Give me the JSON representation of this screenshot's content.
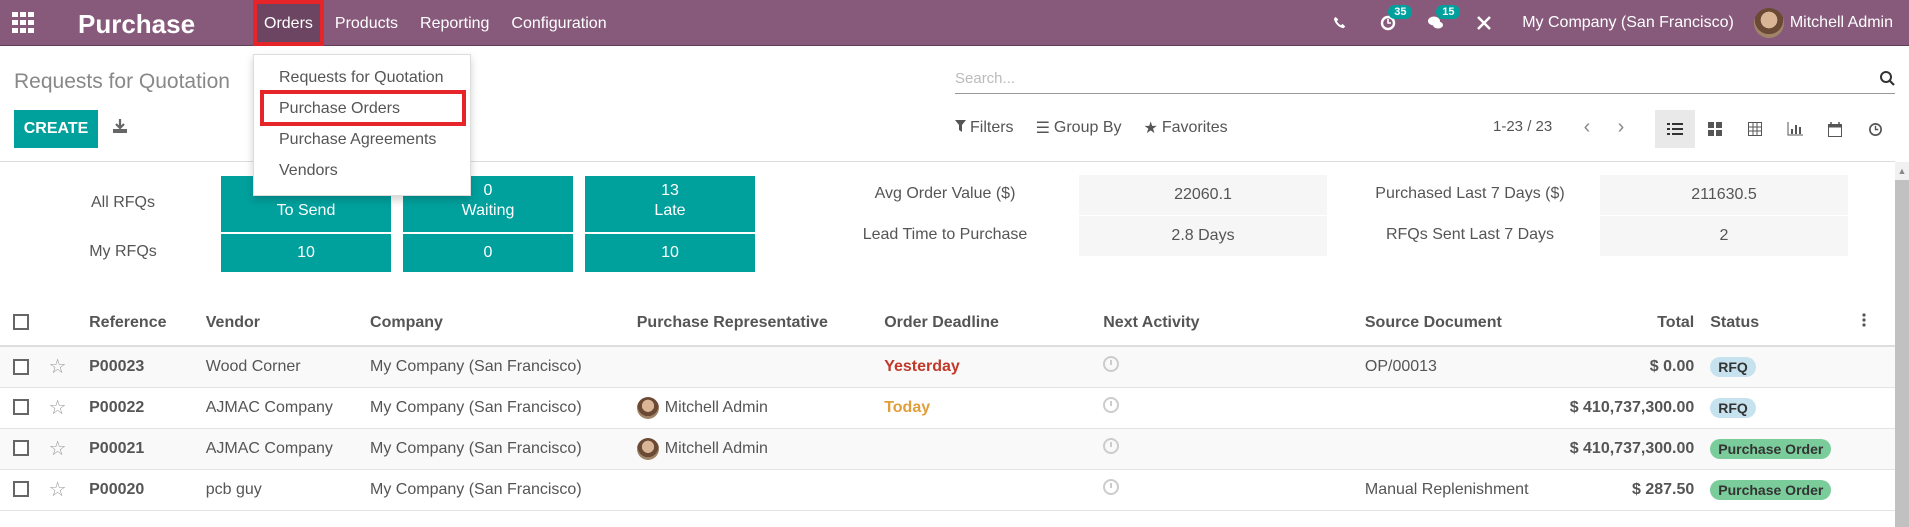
{
  "navbar": {
    "app_title": "Purchase",
    "menus": [
      "Orders",
      "Products",
      "Reporting",
      "Configuration"
    ],
    "active_menu": "Orders",
    "activity_count": "35",
    "message_count": "15",
    "company": "My Company (San Francisco)",
    "user": "Mitchell Admin"
  },
  "orders_dropdown": {
    "items": [
      "Requests for Quotation",
      "Purchase Orders",
      "Purchase Agreements",
      "Vendors"
    ],
    "highlighted": "Purchase Orders"
  },
  "control_panel": {
    "title": "Requests for Quotation",
    "create_label": "CREATE",
    "search_placeholder": "Search...",
    "filters_label": "Filters",
    "groupby_label": "Group By",
    "favorites_label": "Favorites",
    "pager": "1-23 / 23",
    "views": [
      "list",
      "kanban",
      "pivot",
      "graph",
      "calendar",
      "activity"
    ],
    "active_view": "list"
  },
  "dashboard": {
    "row_labels": [
      "All RFQs",
      "My RFQs"
    ],
    "tiles": [
      {
        "label": "To Send",
        "all": "",
        "my": "10"
      },
      {
        "label": "Waiting",
        "all": "0",
        "my": "0"
      },
      {
        "label": "Late",
        "all": "13",
        "my": "10"
      }
    ],
    "kpis": [
      {
        "label": "Avg Order Value ($)",
        "value": "22060.1"
      },
      {
        "label": "Purchased Last 7 Days ($)",
        "value": "211630.5"
      },
      {
        "label": "Lead Time to Purchase",
        "value": "2.8  Days"
      },
      {
        "label": "RFQs Sent Last 7 Days",
        "value": "2"
      }
    ]
  },
  "table": {
    "columns": [
      "Reference",
      "Vendor",
      "Company",
      "Purchase Representative",
      "Order Deadline",
      "Next Activity",
      "Source Document",
      "Total",
      "Status"
    ],
    "rows": [
      {
        "reference": "P00023",
        "vendor": "Wood Corner",
        "company": "My Company (San Francisco)",
        "rep": "",
        "deadline": "Yesterday",
        "deadline_state": "overdue",
        "source": "OP/00013",
        "total": "$ 0.00",
        "status": "RFQ"
      },
      {
        "reference": "P00022",
        "vendor": "AJMAC Company",
        "company": "My Company (San Francisco)",
        "rep": "Mitchell Admin",
        "deadline": "Today",
        "deadline_state": "today",
        "source": "",
        "total": "$ 410,737,300.00",
        "status": "RFQ"
      },
      {
        "reference": "P00021",
        "vendor": "AJMAC Company",
        "company": "My Company (San Francisco)",
        "rep": "Mitchell Admin",
        "deadline": "",
        "deadline_state": "",
        "source": "",
        "total": "$ 410,737,300.00",
        "status": "Purchase Order"
      },
      {
        "reference": "P00020",
        "vendor": "pcb guy",
        "company": "My Company (San Francisco)",
        "rep": "",
        "deadline": "",
        "deadline_state": "",
        "source": "Manual Replenishment",
        "total": "$ 287.50",
        "status": "Purchase Order"
      }
    ]
  },
  "colors": {
    "navbar": "#875a7b",
    "primary": "#00a09d",
    "highlight_box": "#e5252a",
    "overdue": "#c0392b",
    "today": "#e19f3b",
    "rfq_badge": "#c6e2ee",
    "po_badge": "#7bcc9b"
  }
}
